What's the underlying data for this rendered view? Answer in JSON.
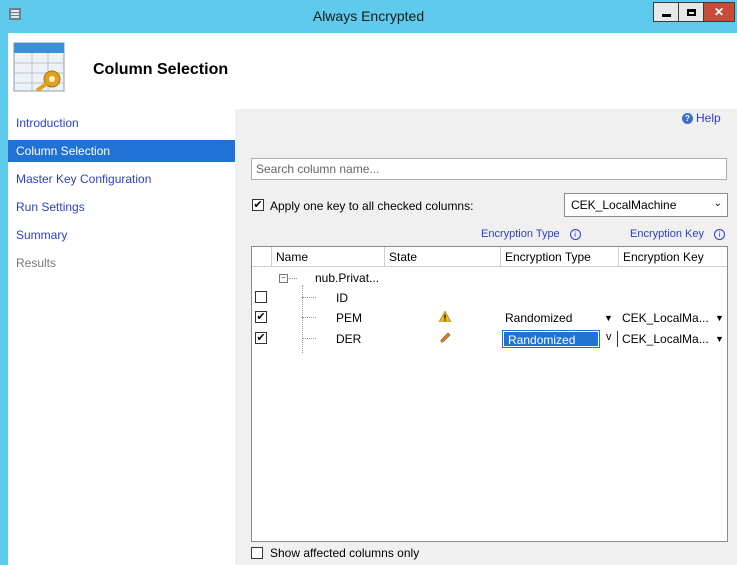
{
  "window": {
    "title": "Always Encrypted"
  },
  "header": {
    "title": "Column Selection"
  },
  "sidebar": {
    "items": [
      {
        "label": "Introduction"
      },
      {
        "label": "Column Selection"
      },
      {
        "label": "Master Key Configuration"
      },
      {
        "label": "Run Settings"
      },
      {
        "label": "Summary"
      },
      {
        "label": "Results"
      }
    ]
  },
  "help": {
    "label": "Help"
  },
  "search": {
    "placeholder": "Search column name..."
  },
  "apply_key": {
    "label": "Apply one key to all checked columns:",
    "checked": true,
    "selected_key": "CEK_LocalMachine"
  },
  "links": {
    "encryption_type": "Encryption Type",
    "encryption_key": "Encryption Key"
  },
  "grid": {
    "headers": [
      "Name",
      "State",
      "Encryption Type",
      "Encryption Key"
    ],
    "group": "nub.Privat...",
    "rows": [
      {
        "name": "ID",
        "checked": false,
        "state": "",
        "enc_type": "",
        "enc_key": ""
      },
      {
        "name": "PEM",
        "checked": true,
        "state": "warning-icon",
        "enc_type": "Randomized",
        "enc_key": "CEK_LocalMa..."
      },
      {
        "name": "DER",
        "checked": true,
        "state": "pencil-icon",
        "enc_type": "Randomized",
        "enc_key": "CEK_LocalMa..."
      }
    ]
  },
  "footer": {
    "show_affected_label": "Show affected columns only",
    "checked": false
  }
}
